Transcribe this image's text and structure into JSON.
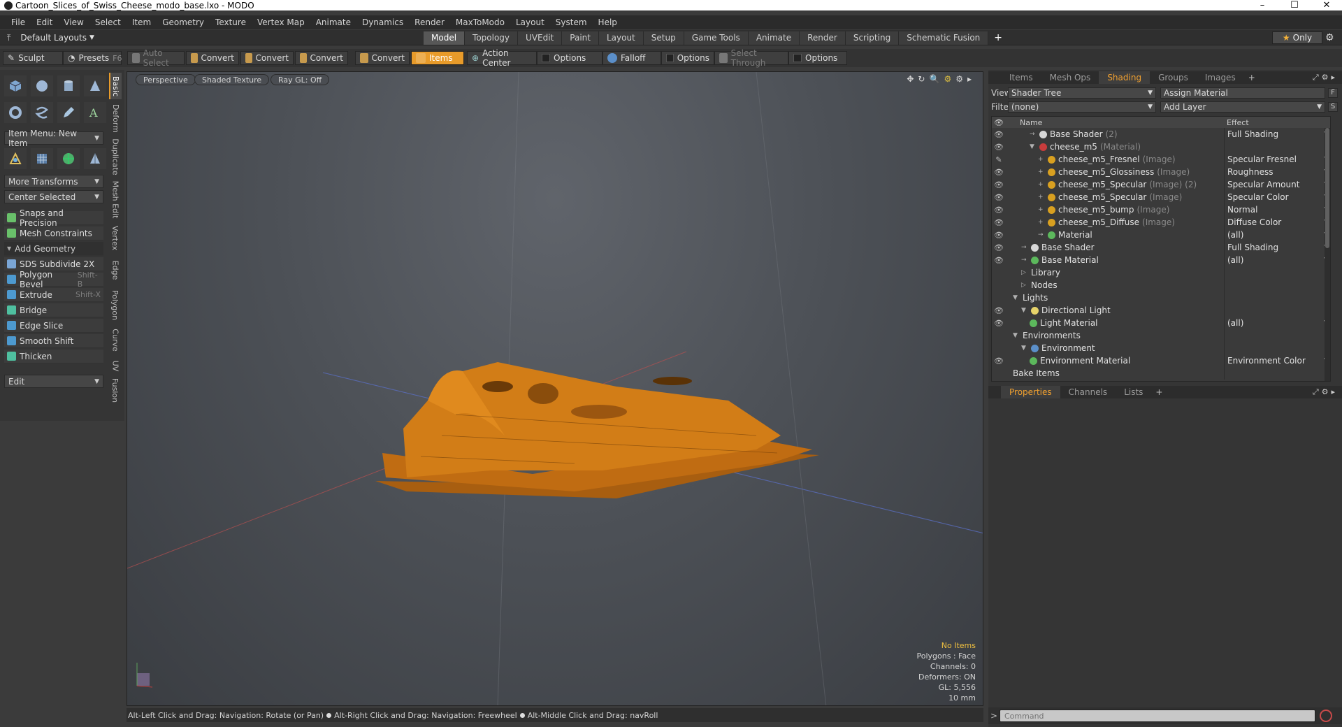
{
  "window": {
    "title": "Cartoon_Slices_of_Swiss_Cheese_modo_base.lxo - MODO",
    "controls": [
      "–",
      "☐",
      "✕"
    ]
  },
  "menu": [
    "File",
    "Edit",
    "View",
    "Select",
    "Item",
    "Geometry",
    "Texture",
    "Vertex Map",
    "Animate",
    "Dynamics",
    "Render",
    "MaxToModo",
    "Layout",
    "System",
    "Help"
  ],
  "layout": {
    "preset": "Default Layouts",
    "tabs": [
      "Model",
      "Topology",
      "UVEdit",
      "Paint",
      "Layout",
      "Setup",
      "Game Tools",
      "Animate",
      "Render",
      "Scripting",
      "Schematic Fusion"
    ],
    "active_tab": "Model",
    "plus": "+",
    "only_label": "Only"
  },
  "toolbar": {
    "sculpt": "Sculpt",
    "presets": "Presets",
    "presets_key": "F6",
    "auto_select": "Auto Select",
    "convert1": "Convert",
    "convert2": "Convert",
    "convert3": "Convert",
    "convert4": "Convert",
    "items": "Items",
    "action_center": "Action Center",
    "options1": "Options",
    "falloff": "Falloff",
    "options2": "Options",
    "select_through": "Select Through",
    "options3": "Options"
  },
  "left": {
    "vtabs": [
      "Basic",
      "Deform",
      "Duplicate",
      "Mesh Edit",
      "Vertex",
      "Edge",
      "Polygon",
      "Curve",
      "UV",
      "Fusion"
    ],
    "item_menu": "Item Menu: New Item",
    "more_transforms": "More Transforms",
    "center_selected": "Center Selected",
    "snaps": "Snaps and Precision",
    "mesh_constraints": "Mesh Constraints",
    "add_geometry": "Add Geometry",
    "tools": [
      {
        "label": "SDS Subdivide 2X",
        "key": ""
      },
      {
        "label": "Polygon Bevel",
        "key": "Shift-B"
      },
      {
        "label": "Extrude",
        "key": "Shift-X"
      },
      {
        "label": "Bridge",
        "key": ""
      },
      {
        "label": "Edge Slice",
        "key": ""
      },
      {
        "label": "Smooth Shift",
        "key": ""
      },
      {
        "label": "Thicken",
        "key": ""
      }
    ],
    "edit_menu": "Edit"
  },
  "viewport": {
    "perspective": "Perspective",
    "shading": "Shaded Texture",
    "raygl": "Ray GL: Off",
    "info": {
      "no_items": "No Items",
      "polygons": "Polygons : Face",
      "channels": "Channels: 0",
      "deformers": "Deformers: ON",
      "gl": "GL: 5,556",
      "grid": "10 mm"
    },
    "model_color": "#d27d17"
  },
  "status": {
    "a": "Alt-Left Click and Drag: Navigation: Rotate (or Pan)",
    "b": "Alt-Right Click and Drag: Navigation: Freewheel",
    "c": "Alt-Middle Click and Drag: navRoll"
  },
  "right": {
    "tabs": [
      "Items",
      "Mesh Ops",
      "Shading",
      "Groups",
      "Images"
    ],
    "active_tab": "Shading",
    "view_label": "View",
    "view_value": "Shader Tree",
    "assign_material": "Assign Material",
    "filter_label": "Filter",
    "filter_value": "(none)",
    "add_layer": "Add Layer",
    "col_name": "Name",
    "col_effect": "Effect",
    "rows": [
      {
        "name": "Base Shader",
        "sub": "(2)",
        "effect": "Full Shading",
        "indent": 2,
        "ball": "#d8d8d8",
        "eye": "👁",
        "tw": "→"
      },
      {
        "name": "cheese_m5",
        "sub": "(Material)",
        "effect": "",
        "indent": 2,
        "ball": "#c83c3c",
        "eye": "👁",
        "tw": "▼"
      },
      {
        "name": "cheese_m5_Fresnel",
        "sub": "(Image)",
        "effect": "Specular Fresnel",
        "indent": 3,
        "ball": "#d9a020",
        "eye": "✎",
        "tw": "+"
      },
      {
        "name": "cheese_m5_Glossiness",
        "sub": "(Image)",
        "effect": "Roughness",
        "indent": 3,
        "ball": "#d9a020",
        "eye": "👁",
        "tw": "+"
      },
      {
        "name": "cheese_m5_Specular",
        "sub": "(Image) (2)",
        "effect": "Specular Amount",
        "indent": 3,
        "ball": "#d9a020",
        "eye": "👁",
        "tw": "+"
      },
      {
        "name": "cheese_m5_Specular",
        "sub": "(Image)",
        "effect": "Specular Color",
        "indent": 3,
        "ball": "#d9a020",
        "eye": "👁",
        "tw": "+"
      },
      {
        "name": "cheese_m5_bump",
        "sub": "(Image)",
        "effect": "Normal",
        "indent": 3,
        "ball": "#d9a020",
        "eye": "👁",
        "tw": "+"
      },
      {
        "name": "cheese_m5_Diffuse",
        "sub": "(Image)",
        "effect": "Diffuse Color",
        "indent": 3,
        "ball": "#d9a020",
        "eye": "👁",
        "tw": "+"
      },
      {
        "name": "Material",
        "sub": "",
        "effect": "(all)",
        "indent": 3,
        "ball": "#5cb85c",
        "eye": "👁",
        "tw": "→"
      },
      {
        "name": "Base Shader",
        "sub": "",
        "effect": "Full Shading",
        "indent": 1,
        "ball": "#d8d8d8",
        "eye": "👁",
        "tw": "→"
      },
      {
        "name": "Base Material",
        "sub": "",
        "effect": "(all)",
        "indent": 1,
        "ball": "#5cb85c",
        "eye": "👁",
        "tw": "→"
      },
      {
        "name": "Library",
        "sub": "",
        "effect": "",
        "indent": 1,
        "ball": "",
        "eye": "",
        "tw": "▷"
      },
      {
        "name": "Nodes",
        "sub": "",
        "effect": "",
        "indent": 1,
        "ball": "",
        "eye": "",
        "tw": "▷"
      },
      {
        "name": "Lights",
        "sub": "",
        "effect": "",
        "indent": 0,
        "ball": "",
        "eye": "",
        "tw": "▼"
      },
      {
        "name": "Directional Light",
        "sub": "",
        "effect": "",
        "indent": 1,
        "ball": "#e6d36a",
        "eye": "👁",
        "tw": "▼"
      },
      {
        "name": "Light Material",
        "sub": "",
        "effect": "(all)",
        "indent": 2,
        "ball": "#5cb85c",
        "eye": "👁",
        "tw": ""
      },
      {
        "name": "Environments",
        "sub": "",
        "effect": "",
        "indent": 0,
        "ball": "",
        "eye": "",
        "tw": "▼"
      },
      {
        "name": "Environment",
        "sub": "",
        "effect": "",
        "indent": 1,
        "ball": "#5b8fc9",
        "eye": "",
        "tw": "▼"
      },
      {
        "name": "Environment Material",
        "sub": "",
        "effect": "Environment Color",
        "indent": 2,
        "ball": "#5cb85c",
        "eye": "👁",
        "tw": ""
      },
      {
        "name": "Bake Items",
        "sub": "",
        "effect": "",
        "indent": 0,
        "ball": "",
        "eye": "",
        "tw": ""
      }
    ],
    "prop_tabs": [
      "Properties",
      "Channels",
      "Lists"
    ],
    "command_placeholder": "Command"
  }
}
